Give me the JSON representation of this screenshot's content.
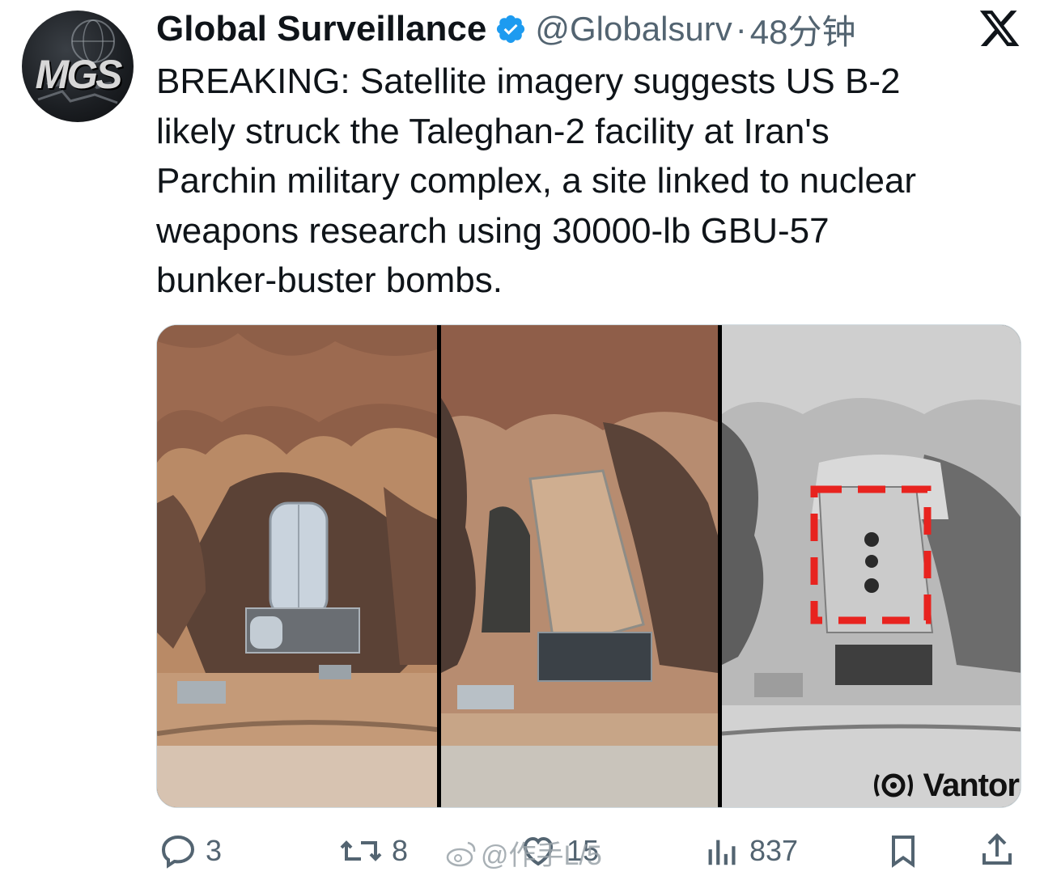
{
  "author": {
    "name": "Global Surveillance",
    "handle": "@Globalsurv",
    "separator": "·",
    "time": "48分钟",
    "avatar_text": "MGS",
    "verified_icon": "verified-badge-icon",
    "verified_color": "#1d9bf0"
  },
  "tweet": {
    "lines": [
      "BREAKING: Satellite imagery suggests US B-2",
      "likely struck the Taleghan-2 facility at Iran's",
      "Parchin military complex, a site linked to nuclear",
      "weapons research using 30000-lb GBU-57",
      "bunker-buster bombs."
    ]
  },
  "media": {
    "watermark": "Vantor",
    "highlight_color": "#e8231f"
  },
  "actions": {
    "reply_count": "3",
    "retweet_count": "8",
    "like_count": "15",
    "views_count": "837"
  },
  "overlay": {
    "weibo_watermark": "@作手L/5"
  },
  "colors": {
    "text": "#0f1419",
    "secondary": "#536471"
  }
}
